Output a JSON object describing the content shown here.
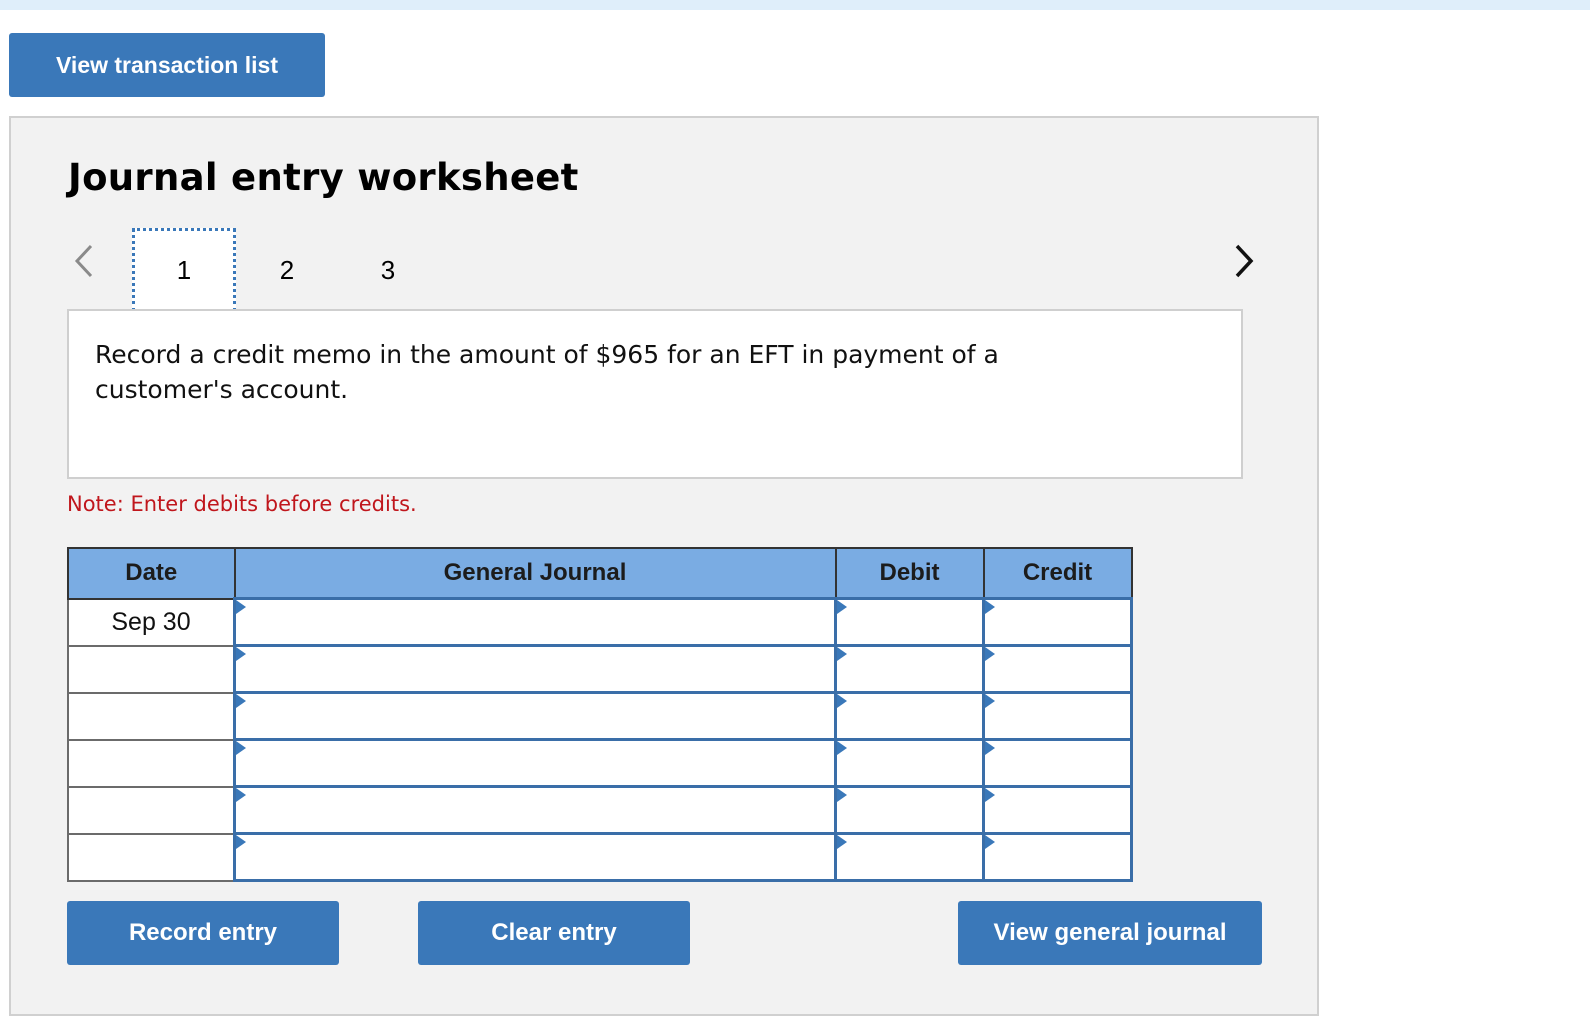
{
  "header": {
    "view_transaction_list_label": "View transaction list"
  },
  "worksheet": {
    "title": "Journal entry worksheet",
    "pages": [
      "1",
      "2",
      "3"
    ],
    "active_page": "1",
    "description": "Record a credit memo in the amount of $965 for an EFT in payment of a customer's account.",
    "note": "Note: Enter debits before credits."
  },
  "table": {
    "headers": {
      "date": "Date",
      "general_journal": "General Journal",
      "debit": "Debit",
      "credit": "Credit"
    },
    "rows": [
      {
        "date": "Sep 30",
        "account": "",
        "debit": "",
        "credit": ""
      },
      {
        "date": "",
        "account": "",
        "debit": "",
        "credit": ""
      },
      {
        "date": "",
        "account": "",
        "debit": "",
        "credit": ""
      },
      {
        "date": "",
        "account": "",
        "debit": "",
        "credit": ""
      },
      {
        "date": "",
        "account": "",
        "debit": "",
        "credit": ""
      },
      {
        "date": "",
        "account": "",
        "debit": "",
        "credit": ""
      }
    ]
  },
  "actions": {
    "record_entry_label": "Record entry",
    "clear_entry_label": "Clear entry",
    "view_general_journal_label": "View general journal"
  },
  "icons": {
    "prev": "chevron-left-icon",
    "next": "chevron-right-icon"
  },
  "colors": {
    "button_blue": "#3a78b9",
    "header_blue": "#7aace3",
    "note_red": "#c0161c",
    "panel_gray": "#f2f2f2"
  }
}
